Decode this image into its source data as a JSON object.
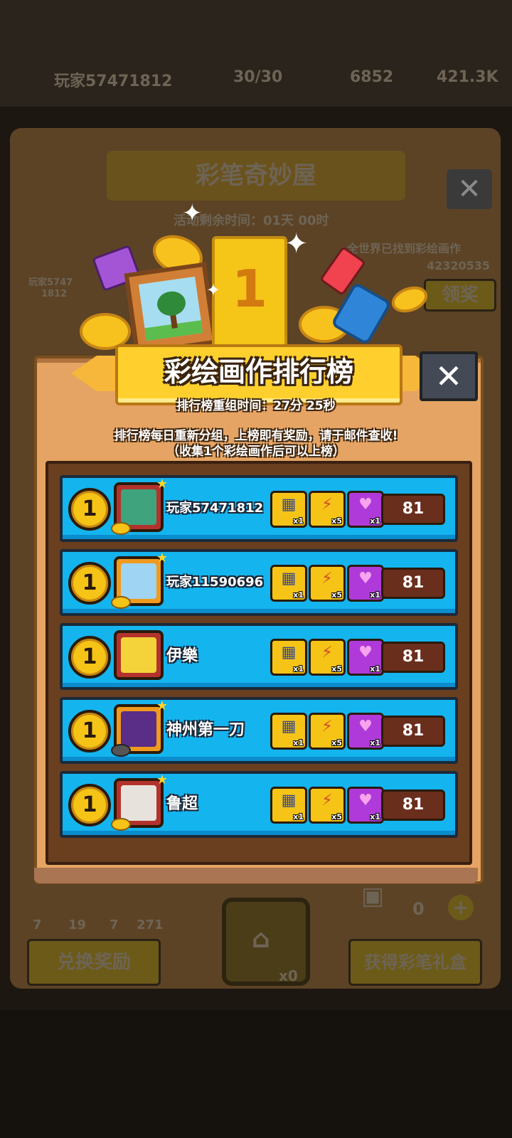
{
  "background": {
    "player_name": "玩家57471812",
    "pencil_stat": "30/30",
    "gem_stat": "6852",
    "coin_stat": "421.3K",
    "shop_title": "彩笔奇妙屋",
    "time_left": "活动剩余时间：01天 00时",
    "world_found_label": "全世界已找到彩绘画作",
    "world_found_count": "42320535",
    "claim_button": "领奖",
    "avatar_name_line1": "玩家5747",
    "avatar_name_line2": "1812",
    "pencil_counts": [
      "7",
      "19",
      "7",
      "271"
    ],
    "exchange_button": "兑换奖励",
    "lock_count": "x0",
    "gift_count": "0",
    "get_pencil_box_button": "获得彩笔礼盒"
  },
  "popup": {
    "trophy_number": "1",
    "title": "彩绘画作排行榜",
    "close_label": "✕",
    "reset_time": "排行榜重组时间：27分 25秒",
    "info_line1": "排行榜每日重新分组，上榜即有奖励，请于邮件查收!",
    "info_line2": "（收集1个彩绘画作后可以上榜）"
  },
  "leaderboard": [
    {
      "rank": "1",
      "name": "玩家57471812",
      "chest_qty": "x1",
      "shoe_qty": "x5",
      "heart_qty": "x1",
      "score": "81"
    },
    {
      "rank": "1",
      "name": "玩家11590696",
      "chest_qty": "x1",
      "shoe_qty": "x5",
      "heart_qty": "x1",
      "score": "81"
    },
    {
      "rank": "1",
      "name": "伊樂",
      "chest_qty": "x1",
      "shoe_qty": "x5",
      "heart_qty": "x1",
      "score": "81"
    },
    {
      "rank": "1",
      "name": "神州第一刀",
      "chest_qty": "x1",
      "shoe_qty": "x5",
      "heart_qty": "x1",
      "score": "81"
    },
    {
      "rank": "1",
      "name": "鲁超",
      "chest_qty": "x1",
      "shoe_qty": "x5",
      "heart_qty": "x1",
      "score": "81"
    }
  ],
  "colors": {
    "row_blue": "#14b4ef",
    "banner_yellow": "#ffd02d",
    "panel_wood": "#e5a463",
    "score_brown": "#6a2e1d"
  }
}
